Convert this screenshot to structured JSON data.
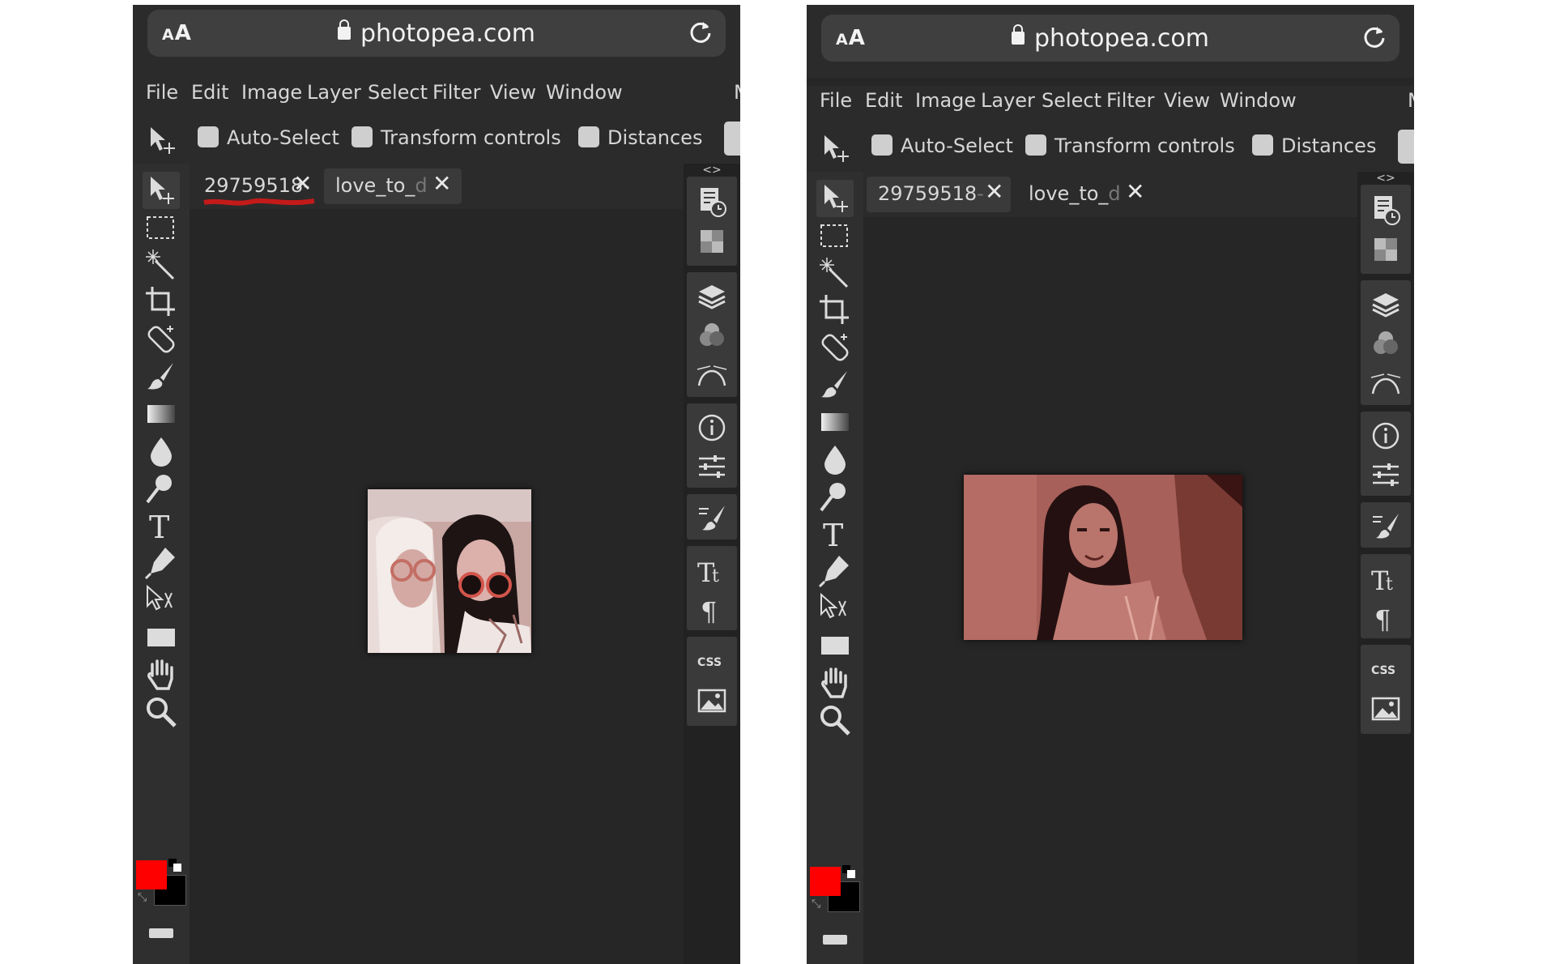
{
  "browser": {
    "aa_label_big": "A",
    "aa_label_small": "A",
    "url": "photopea.com"
  },
  "menu": [
    "File",
    "Edit",
    "Image",
    "Layer",
    "Select",
    "Filter",
    "View",
    "Window",
    "M"
  ],
  "options": {
    "auto_select": "Auto-Select",
    "transform_controls": "Transform controls",
    "distances": "Distances"
  },
  "panel_toggle": "<>",
  "css_label": "CSS",
  "left_screen": {
    "tabs": [
      {
        "label": "29759518",
        "fade": "-",
        "active": false
      },
      {
        "label": "love_to_",
        "fade": "d",
        "active": true
      }
    ]
  },
  "right_screen": {
    "tabs": [
      {
        "label": "29759518",
        "fade": "-",
        "active": true
      },
      {
        "label": "love_to_",
        "fade": "d",
        "active": false
      }
    ]
  },
  "colors": {
    "foreground": "#ff0000",
    "background": "#000000",
    "ui_dark": "#262626",
    "accent_red_tint": "#a8605a"
  },
  "tools": [
    "move-tool",
    "marquee-tool",
    "magic-wand-tool",
    "crop-tool",
    "healing-tool",
    "brush-tool",
    "gradient-tool",
    "blur-tool",
    "dodge-tool",
    "type-tool",
    "pen-tool",
    "path-select-tool",
    "rectangle-tool",
    "hand-tool",
    "zoom-tool"
  ]
}
